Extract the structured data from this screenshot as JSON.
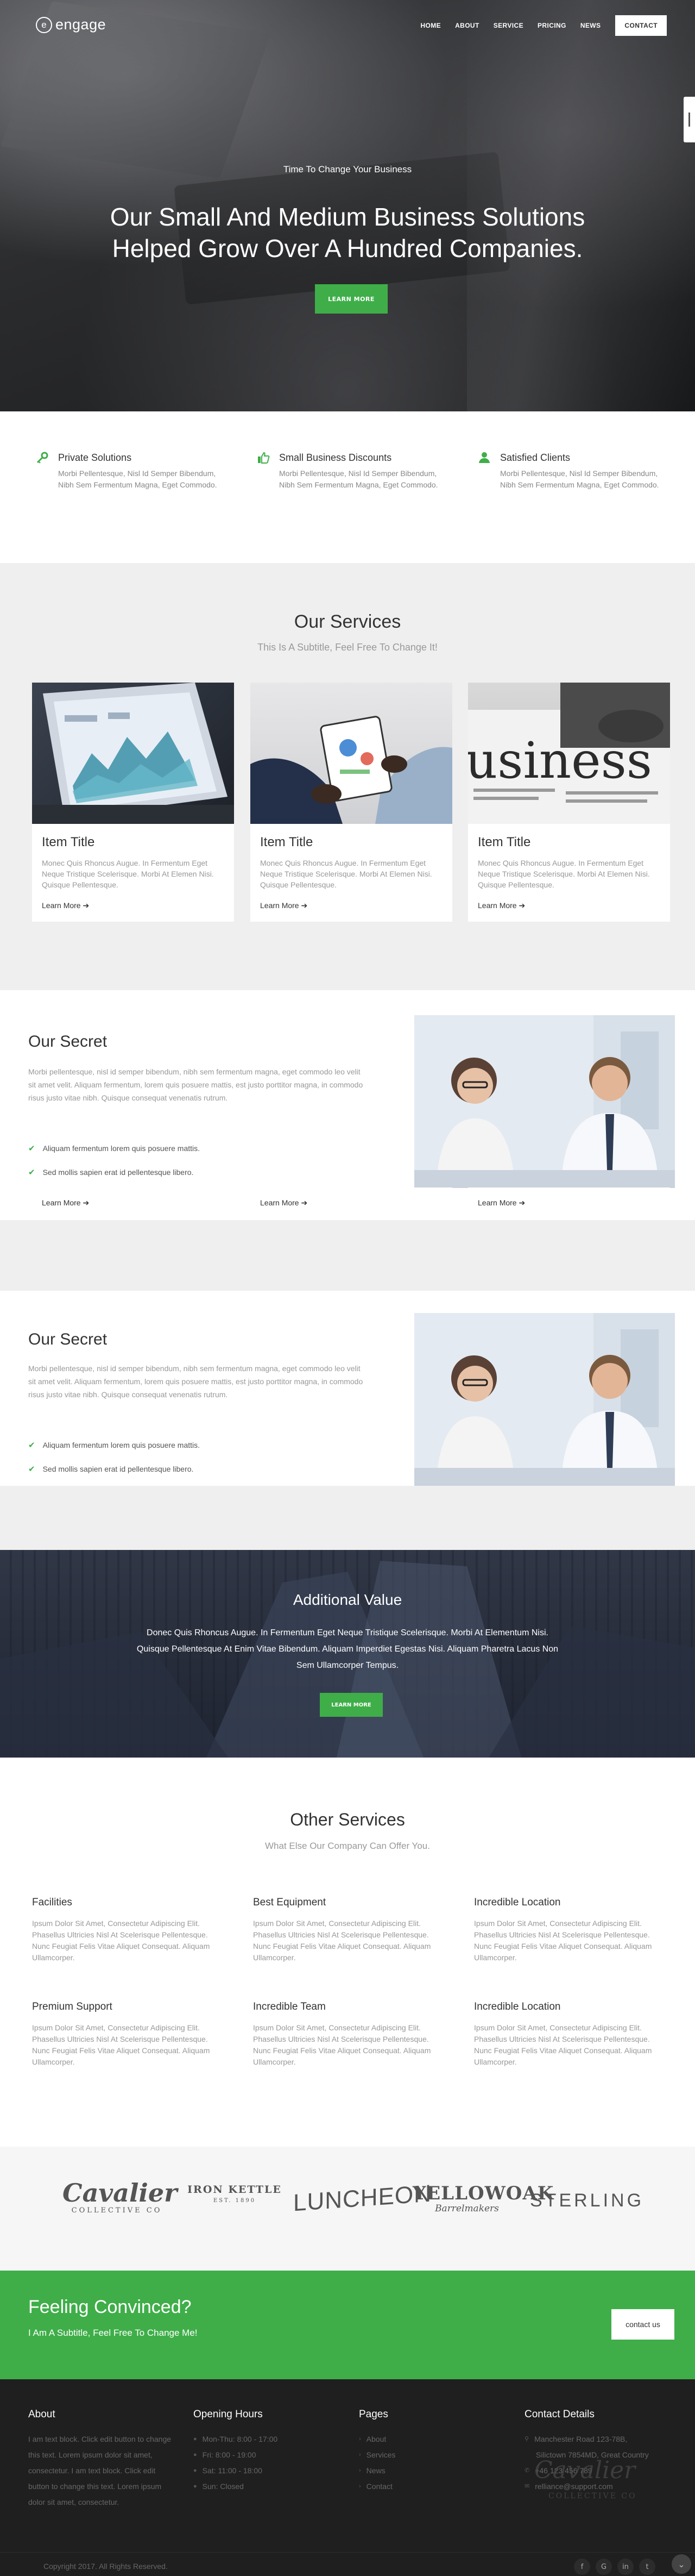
{
  "header": {
    "logo_mark": "e",
    "logo_text": "engage",
    "nav": [
      "HOME",
      "ABOUT",
      "SERVICE",
      "PRICING",
      "NEWS"
    ],
    "contact_label": "CONTACT"
  },
  "hero": {
    "subtitle": "Time To Change Your Business",
    "title": "Our Small And Medium Business Solutions Helped Grow Over A Hundred Companies.",
    "button": "LEARN MORE"
  },
  "features": [
    {
      "icon": "key-icon",
      "title": "Private Solutions",
      "text": "Morbi Pellentesque, Nisl Id Semper Bibendum, Nibh Sem Fermentum Magna, Eget Commodo."
    },
    {
      "icon": "thumbs-up-icon",
      "title": "Small Business Discounts",
      "text": "Morbi Pellentesque, Nisl Id Semper Bibendum, Nibh Sem Fermentum Magna, Eget Commodo."
    },
    {
      "icon": "user-check-icon",
      "title": "Satisfied Clients",
      "text": "Morbi Pellentesque, Nisl Id Semper Bibendum, Nibh Sem Fermentum Magna, Eget Commodo."
    }
  ],
  "services": {
    "title": "Our Services",
    "subtitle": "This Is A Subtitle, Feel Free To Change It!",
    "cards": [
      {
        "title": "Item Title",
        "text": "Monec Quis Rhoncus Augue. In Fermentum Eget Neque Tristique Scelerisque. Morbi At Elemen Nisi. Quisque Pellentesque.",
        "link": "Learn More"
      },
      {
        "title": "Item Title",
        "text": "Monec Quis Rhoncus Augue. In Fermentum Eget Neque Tristique Scelerisque. Morbi At Elemen Nisi. Quisque Pellentesque.",
        "link": "Learn More"
      },
      {
        "title": "Item Title",
        "text": "Monec Quis Rhoncus Augue. In Fermentum Eget Neque Tristique Scelerisque. Morbi At Elemen Nisi. Quisque Pellentesque.",
        "link": "Learn More"
      }
    ],
    "newspaper_word": "usiness"
  },
  "secret": {
    "title": "Our Secret",
    "text": "Morbi pellentesque, nisl id semper bibendum, nibh sem fermentum magna, eget commodo leo velit sit amet velit. Aliquam fermentum, lorem quis posuere mattis, est justo porttitor magna, in commodo risus justo vitae nibh. Quisque consequat venenatis rutrum.",
    "checks": [
      "Aliquam fermentum lorem quis posuere mattis.",
      "Sed mollis sapien erat id pellentesque libero."
    ],
    "link": "Learn More"
  },
  "additional": {
    "title": "Additional Value",
    "text": "Donec Quis Rhoncus Augue. In Fermentum Eget Neque Tristique Scelerisque. Morbi At Elementum Nisi. Quisque Pellentesque At Enim Vitae Bibendum. Aliquam Imperdiet Egestas Nisi. Aliquam Pharetra Lacus Non Sem Ullamcorper Tempus.",
    "button": "LEARN MORE"
  },
  "other": {
    "title": "Other Services",
    "subtitle": "What Else Our Company Can Offer You.",
    "items": [
      {
        "title": "Facilities",
        "text": "Ipsum Dolor Sit Amet, Consectetur Adipiscing Elit. Phasellus Ultricies Nisl At Scelerisque Pellentesque. Nunc Feugiat Felis Vitae Aliquet Consequat. Aliquam Ullamcorper."
      },
      {
        "title": "Best Equipment",
        "text": "Ipsum Dolor Sit Amet, Consectetur Adipiscing Elit. Phasellus Ultricies Nisl At Scelerisque Pellentesque. Nunc Feugiat Felis Vitae Aliquet Consequat. Aliquam Ullamcorper."
      },
      {
        "title": "Incredible Location",
        "text": "Ipsum Dolor Sit Amet, Consectetur Adipiscing Elit. Phasellus Ultricies Nisl At Scelerisque Pellentesque. Nunc Feugiat Felis Vitae Aliquet Consequat. Aliquam Ullamcorper."
      },
      {
        "title": "Premium Support",
        "text": "Ipsum Dolor Sit Amet, Consectetur Adipiscing Elit. Phasellus Ultricies Nisl At Scelerisque Pellentesque. Nunc Feugiat Felis Vitae Aliquet Consequat. Aliquam Ullamcorper."
      },
      {
        "title": "Incredible Team",
        "text": "Ipsum Dolor Sit Amet, Consectetur Adipiscing Elit. Phasellus Ultricies Nisl At Scelerisque Pellentesque. Nunc Feugiat Felis Vitae Aliquet Consequat. Aliquam Ullamcorper."
      },
      {
        "title": "Incredible Location",
        "text": "Ipsum Dolor Sit Amet, Consectetur Adipiscing Elit. Phasellus Ultricies Nisl At Scelerisque Pellentesque. Nunc Feugiat Felis Vitae Aliquet Consequat. Aliquam Ullamcorper."
      }
    ]
  },
  "brands": {
    "cavalier": "Cavalier",
    "cavalier_sub": "COLLECTIVE CO",
    "ironkettle": "IRON KETTLE",
    "ironkettle_sub": "EST. 1890",
    "luncheon": "LUNCHEON",
    "yellowoak": "YELLOWOAK",
    "yellowoak_sub": "Barrelmakers",
    "sterling": "STERLING"
  },
  "cta": {
    "title": "Feeling Convinced?",
    "subtitle": "I Am A Subtitle, Feel Free To Change Me!",
    "button": "contact us"
  },
  "footer": {
    "about_title": "About",
    "about_text": "I am text block. Click edit button to change this text. Lorem ipsum dolor sit amet, consectetur. I am text block. Click edit button to change this text. Lorem ipsum dolor sit amet, consectetur.",
    "hours_title": "Opening Hours",
    "hours": [
      "Mon-Thu: 8:00 - 17:00",
      "Fri: 8:00 - 19:00",
      "Sat: 11:00 - 18:00",
      "Sun: Closed"
    ],
    "pages_title": "Pages",
    "pages": [
      "About",
      "Services",
      "News",
      "Contact"
    ],
    "contact_title": "Contact Details",
    "contact": [
      "Manchester Road 123-78B,",
      "Silictown 7854MD, Great Country",
      "+46 123 456 789",
      "relliance@support.com"
    ],
    "copyright": "Copyright 2017. All Rights Reserved.",
    "social": [
      "f",
      "G",
      "in",
      "t"
    ]
  },
  "colors": {
    "accent": "#3fae49",
    "footer_bg": "#1f1f1f"
  }
}
